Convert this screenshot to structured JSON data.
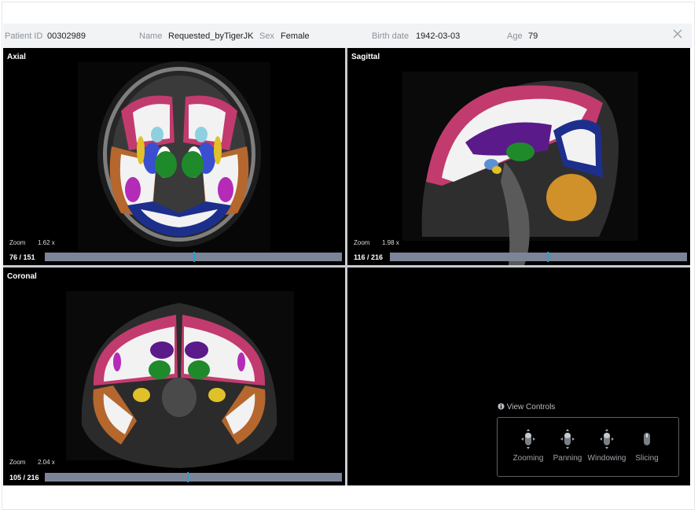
{
  "patient": {
    "id_label": "Patient ID",
    "id_value": "00302989",
    "name_label": "Name",
    "name_value": "Requested_byTigerJK",
    "sex_label": "Sex",
    "sex_value": "Female",
    "birth_label": "Birth date",
    "birth_value": "1942-03-03",
    "age_label": "Age",
    "age_value": "79"
  },
  "close_icon": "close-icon",
  "panes": {
    "axial": {
      "title": "Axial",
      "zoom_label": "Zoom",
      "zoom_value": "1.62 x",
      "slice": "76 / 151",
      "slider_fraction": 0.5
    },
    "sagittal": {
      "title": "Sagittal",
      "zoom_label": "Zoom",
      "zoom_value": "1.98 x",
      "slice": "116 / 216",
      "slider_fraction": 0.53
    },
    "coronal": {
      "title": "Coronal",
      "zoom_label": "Zoom",
      "zoom_value": "2.04 x",
      "slice": "105 / 216",
      "slider_fraction": 0.48
    }
  },
  "view_controls": {
    "title": "View Controls",
    "info_icon": "info-icon",
    "items": [
      {
        "label": "Zooming",
        "icon": "mouse-zoom-icon"
      },
      {
        "label": "Panning",
        "icon": "mouse-pan-icon"
      },
      {
        "label": "Windowing",
        "icon": "mouse-window-icon"
      },
      {
        "label": "Slicing",
        "icon": "mouse-scroll-icon"
      }
    ]
  },
  "colors": {
    "cortex": "#c23b6e",
    "white_matter": "#f2f2f2",
    "deep_gray": "#5a1a8a",
    "thalamus": "#1f8a2a",
    "occipital": "#1d2f8c",
    "cerebellum": "#d0902a",
    "temporal": "#b5672e",
    "slider": "#7b8597",
    "thumb": "#1fa3d6"
  }
}
